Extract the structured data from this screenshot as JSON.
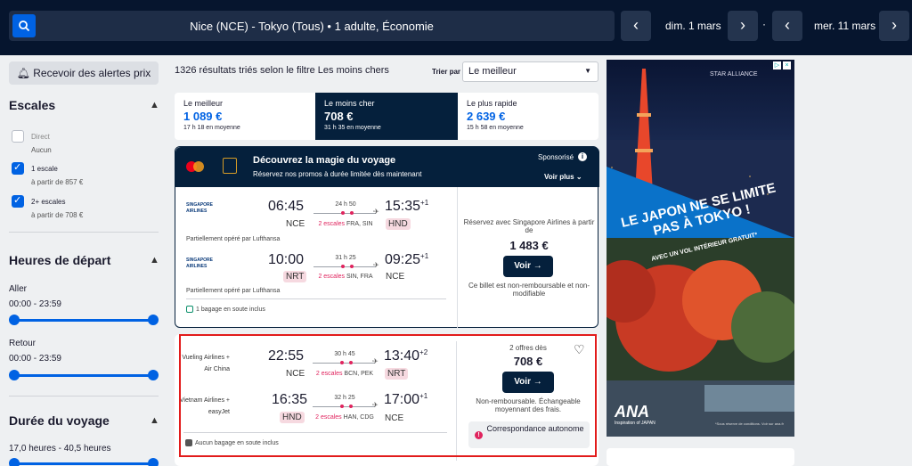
{
  "search": {
    "route": "Nice (NCE) - Tokyo (Tous)  •  1 adulte, Économie",
    "date_out": "dim. 1 mars",
    "date_back": "mer. 11 mars",
    "separator": "·"
  },
  "sidebar": {
    "alert_button": "Recevoir des alertes prix",
    "stops_title": "Escales",
    "stops": [
      {
        "label": "Direct",
        "sub": "Aucun",
        "checked": false
      },
      {
        "label": "1 escale",
        "sub": "à partir de 857 €",
        "checked": true
      },
      {
        "label": "2+ escales",
        "sub": "à partir de 708 €",
        "checked": true
      }
    ],
    "departure_title": "Heures de départ",
    "outbound_label": "Aller",
    "outbound_range": "00:00 - 23:59",
    "return_label": "Retour",
    "return_range": "00:00 - 23:59",
    "duration_title": "Durée du voyage",
    "duration_range": "17,0 heures - 40,5 heures"
  },
  "results": {
    "count_text": "1326 résultats triés selon le filtre Les moins chers",
    "sort_label": "Trier par",
    "sort_value": "Le meilleur",
    "tabs": [
      {
        "name": "Le meilleur",
        "price": "1 089 €",
        "duration": "17 h 18 en moyenne",
        "active": false
      },
      {
        "name": "Le moins cher",
        "price": "708 €",
        "duration": "31 h 35 en moyenne",
        "active": true
      },
      {
        "name": "Le plus rapide",
        "price": "2 639 €",
        "duration": "15 h 58 en moyenne",
        "active": false
      }
    ]
  },
  "sponsored": {
    "title": "Découvrez la magie du voyage",
    "subtitle": "Réservez nos promos à durée limitée dès maintenant",
    "tag": "Sponsorisé",
    "see_more": "Voir plus",
    "logo_text": "SINGAPORE AIRLINES",
    "out": {
      "dep_time": "06:45",
      "dep_code": "NCE",
      "duration": "24 h 50",
      "stops_count": "2 escales",
      "stops_places": "FRA, SIN",
      "arr_time": "15:35",
      "arr_plus": "+1",
      "arr_code": "HND"
    },
    "out_note": "Partiellement opéré par Lufthansa",
    "back": {
      "dep_time": "10:00",
      "dep_code": "NRT",
      "duration": "31 h 25",
      "stops_count": "2 escales",
      "stops_places": "SIN, FRA",
      "arr_time": "09:25",
      "arr_plus": "+1",
      "arr_code": "NCE"
    },
    "back_note": "Partiellement opéré par Lufthansa",
    "baggage": "1 bagage en soute inclus",
    "book_with": "Réservez avec Singapore Airlines à partir de",
    "price": "1 483 €",
    "button": "Voir →",
    "condition": "Ce billet est non-remboursable et non-modifiable"
  },
  "result": {
    "out_airline": "Vueling Airlines + Air China",
    "out": {
      "dep_time": "22:55",
      "dep_code": "NCE",
      "duration": "30 h 45",
      "stops_count": "2 escales",
      "stops_places": "BCN, PEK",
      "arr_time": "13:40",
      "arr_plus": "+2",
      "arr_code": "NRT"
    },
    "back_airline": "Vietnam Airlines + easyJet",
    "back": {
      "dep_time": "16:35",
      "dep_code": "HND",
      "duration": "32 h 25",
      "stops_count": "2 escales",
      "stops_places": "HAN, CDG",
      "arr_time": "17:00",
      "arr_plus": "+1",
      "arr_code": "NCE"
    },
    "baggage": "Aucun bagage en soute inclus",
    "offers_from": "2 offres dès",
    "price": "708 €",
    "button": "Voir →",
    "condition": "Non-remboursable. Échangeable moyennant des frais.",
    "self_transfer": "Correspondance autonome"
  },
  "ad": {
    "alliance": "STAR ALLIANCE",
    "headline": "LE JAPON NE SE LIMITE PAS À TOKYO !",
    "subline": "AVEC UN VOL INTÉRIEUR GRATUIT*",
    "brand": "ANA",
    "brand_sub": "Inspiration of JAPAN",
    "fine": "*Sous réserve de conditions. Voir sur ana.fr"
  },
  "colors": {
    "nav_bg": "#06152e",
    "accent_blue": "#0062e3",
    "dark_navy": "#05203c",
    "stops_red": "#e0245e",
    "highlight_border": "#e21b1b"
  }
}
